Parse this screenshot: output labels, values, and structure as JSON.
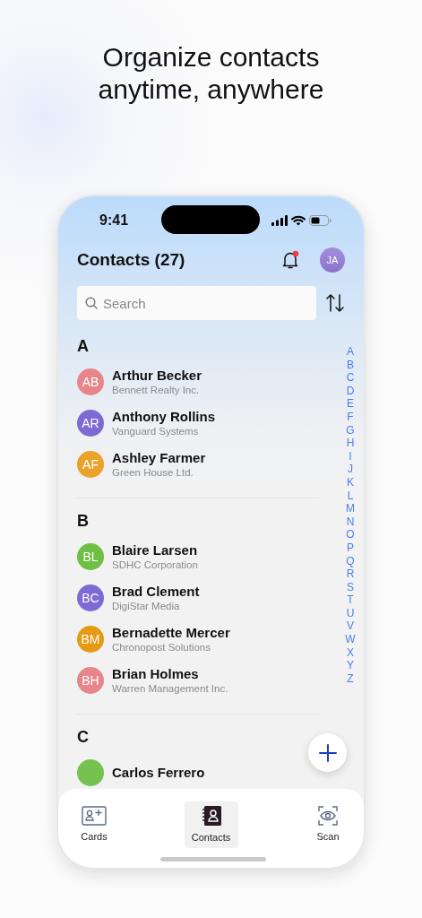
{
  "headline": "Organize contacts anytime, anywhere",
  "status_bar": {
    "time": "9:41"
  },
  "header": {
    "title": "Contacts (27)",
    "notification_dot": true,
    "user_initials": "JA"
  },
  "search": {
    "placeholder": "Search"
  },
  "groups": [
    {
      "letter": "A",
      "contacts": [
        {
          "initials": "AB",
          "name": "Arthur Becker",
          "company": "Bennett Realty Inc.",
          "color": "#e6868a"
        },
        {
          "initials": "AR",
          "name": "Anthony Rollins",
          "company": "Vanguard Systems",
          "color": "#7d6bd3"
        },
        {
          "initials": "AF",
          "name": "Ashley Farmer",
          "company": "Green House Ltd.",
          "color": "#eba22a"
        }
      ]
    },
    {
      "letter": "B",
      "contacts": [
        {
          "initials": "BL",
          "name": "Blaire Larsen",
          "company": "SDHC Corporation",
          "color": "#6fbf45"
        },
        {
          "initials": "BC",
          "name": "Brad Clement",
          "company": "DigiStar Media",
          "color": "#7d6bd3"
        },
        {
          "initials": "BM",
          "name": "Bernadette Mercer",
          "company": "Chronopost Solutions",
          "color": "#e59a14"
        },
        {
          "initials": "BH",
          "name": "Brian Holmes",
          "company": "Warren Management Inc.",
          "color": "#e6868a"
        }
      ]
    },
    {
      "letter": "C",
      "contacts": [
        {
          "name": "Carlos Ferrero",
          "color": "#76c24e"
        }
      ]
    }
  ],
  "index_letters": [
    "A",
    "B",
    "C",
    "D",
    "E",
    "F",
    "G",
    "H",
    "I",
    "J",
    "K",
    "L",
    "M",
    "N",
    "O",
    "P",
    "Q",
    "R",
    "S",
    "T",
    "U",
    "V",
    "W",
    "X",
    "Y",
    "Z"
  ],
  "tabs": [
    {
      "label": "Cards",
      "kind": "cards",
      "selected": false
    },
    {
      "label": "Contacts",
      "kind": "contacts",
      "selected": true
    },
    {
      "label": "Scan",
      "kind": "scan",
      "selected": false
    }
  ]
}
